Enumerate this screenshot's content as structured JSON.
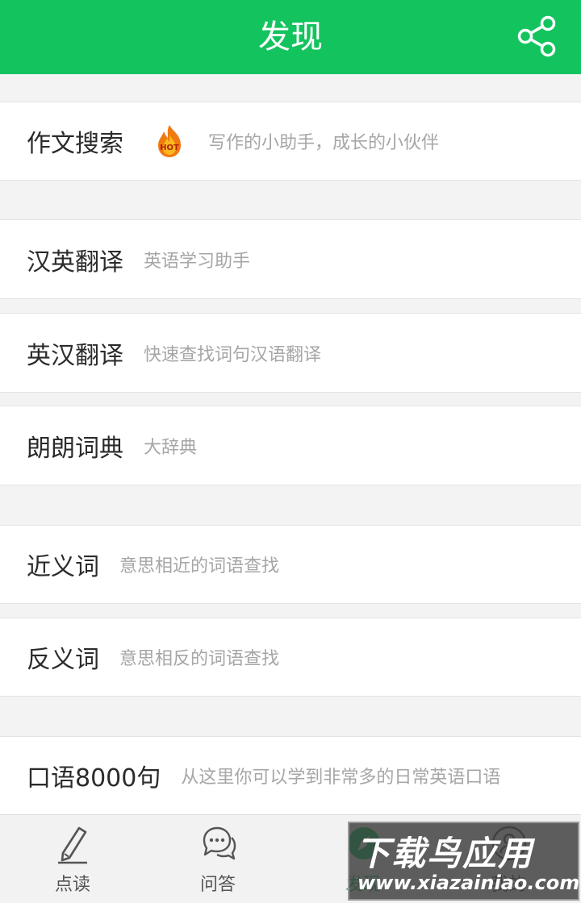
{
  "header": {
    "title": "发现"
  },
  "items": [
    {
      "title": "作文搜索",
      "subtitle": "写作的小助手，成长的小伙伴",
      "badge": "HOT"
    },
    {
      "title": "汉英翻译",
      "subtitle": "英语学习助手"
    },
    {
      "title": "英汉翻译",
      "subtitle": "快速查找词句汉语翻译"
    },
    {
      "title": "朗朗词典",
      "subtitle": "大辞典"
    },
    {
      "title": "近义词",
      "subtitle": "意思相近的词语查找"
    },
    {
      "title": "反义词",
      "subtitle": "意思相反的词语查找"
    },
    {
      "title": "口语8000句",
      "subtitle": "从这里你可以学到非常多的日常英语口语"
    }
  ],
  "tabs": [
    {
      "label": "点读",
      "icon": "pen-icon"
    },
    {
      "label": "问答",
      "icon": "chat-bubbles-icon"
    },
    {
      "label": "发现",
      "icon": "discover-icon",
      "active": true
    },
    {
      "label": "我的",
      "icon": "profile-icon"
    }
  ],
  "watermark": {
    "text": "下载鸟应用",
    "url": "www.xiazainiao.com"
  },
  "colors": {
    "brand": "#13c45e",
    "background": "#f3f3f3",
    "subtitle": "#a6a6a6"
  }
}
